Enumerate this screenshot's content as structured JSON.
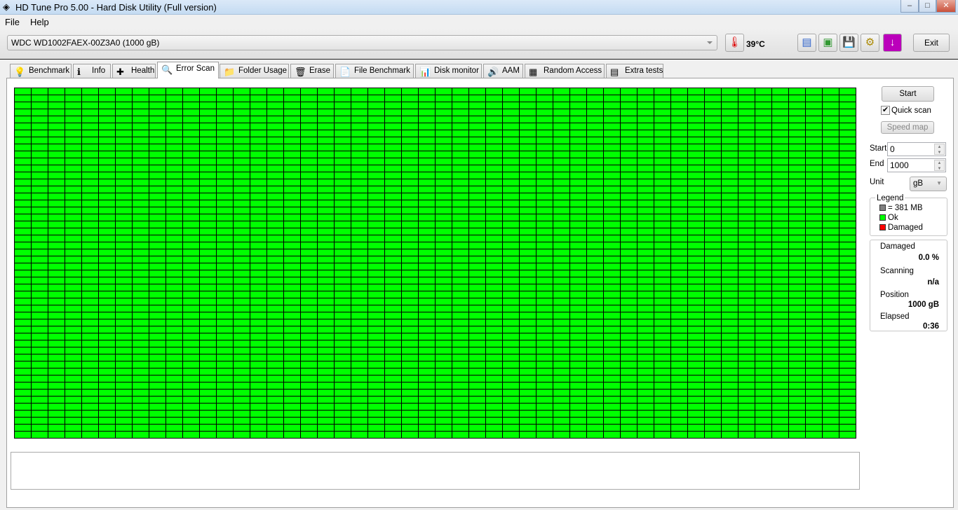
{
  "window": {
    "title": "HD Tune Pro 5.00 - Hard Disk Utility (Full version)",
    "minimize": "–",
    "maximize": "□",
    "close": "✕"
  },
  "menu": {
    "file": "File",
    "help": "Help"
  },
  "toolbar": {
    "drive": "WDC WD1002FAEX-00Z3A0 (1000 gB)",
    "temperature": "39°C",
    "exit": "Exit"
  },
  "tabs": [
    {
      "label": "Benchmark",
      "icon": "💡"
    },
    {
      "label": "Info",
      "icon": "ℹ"
    },
    {
      "label": "Health",
      "icon": "✚"
    },
    {
      "label": "Error Scan",
      "icon": "🔍"
    },
    {
      "label": "Folder Usage",
      "icon": "📁"
    },
    {
      "label": "Erase",
      "icon": "🗑"
    },
    {
      "label": "File Benchmark",
      "icon": "📄"
    },
    {
      "label": "Disk monitor",
      "icon": "📊"
    },
    {
      "label": "AAM",
      "icon": "🔊"
    },
    {
      "label": "Random Access",
      "icon": "▦"
    },
    {
      "label": "Extra tests",
      "icon": "▤"
    }
  ],
  "scan": {
    "start_button": "Start",
    "quick_scan": "Quick scan",
    "quick_scan_checked": true,
    "speed_map": "Speed map",
    "start_label": "Start",
    "start_value": "0",
    "end_label": "End",
    "end_value": "1000",
    "unit_label": "Unit",
    "unit_value": "gB",
    "blocks_ok": 2500,
    "blocks_damaged": 0
  },
  "legend": {
    "title": "Legend",
    "block": "= 381 MB",
    "ok": "Ok",
    "damaged": "Damaged",
    "colors": {
      "block": "#808080",
      "ok": "#00ff00",
      "damaged": "#ff0000"
    }
  },
  "stats": {
    "damaged_label": "Damaged",
    "damaged_value": "0.0 %",
    "scanning_label": "Scanning",
    "scanning_value": "n/a",
    "position_label": "Position",
    "position_value": "1000 gB",
    "elapsed_label": "Elapsed",
    "elapsed_value": "0:36"
  }
}
